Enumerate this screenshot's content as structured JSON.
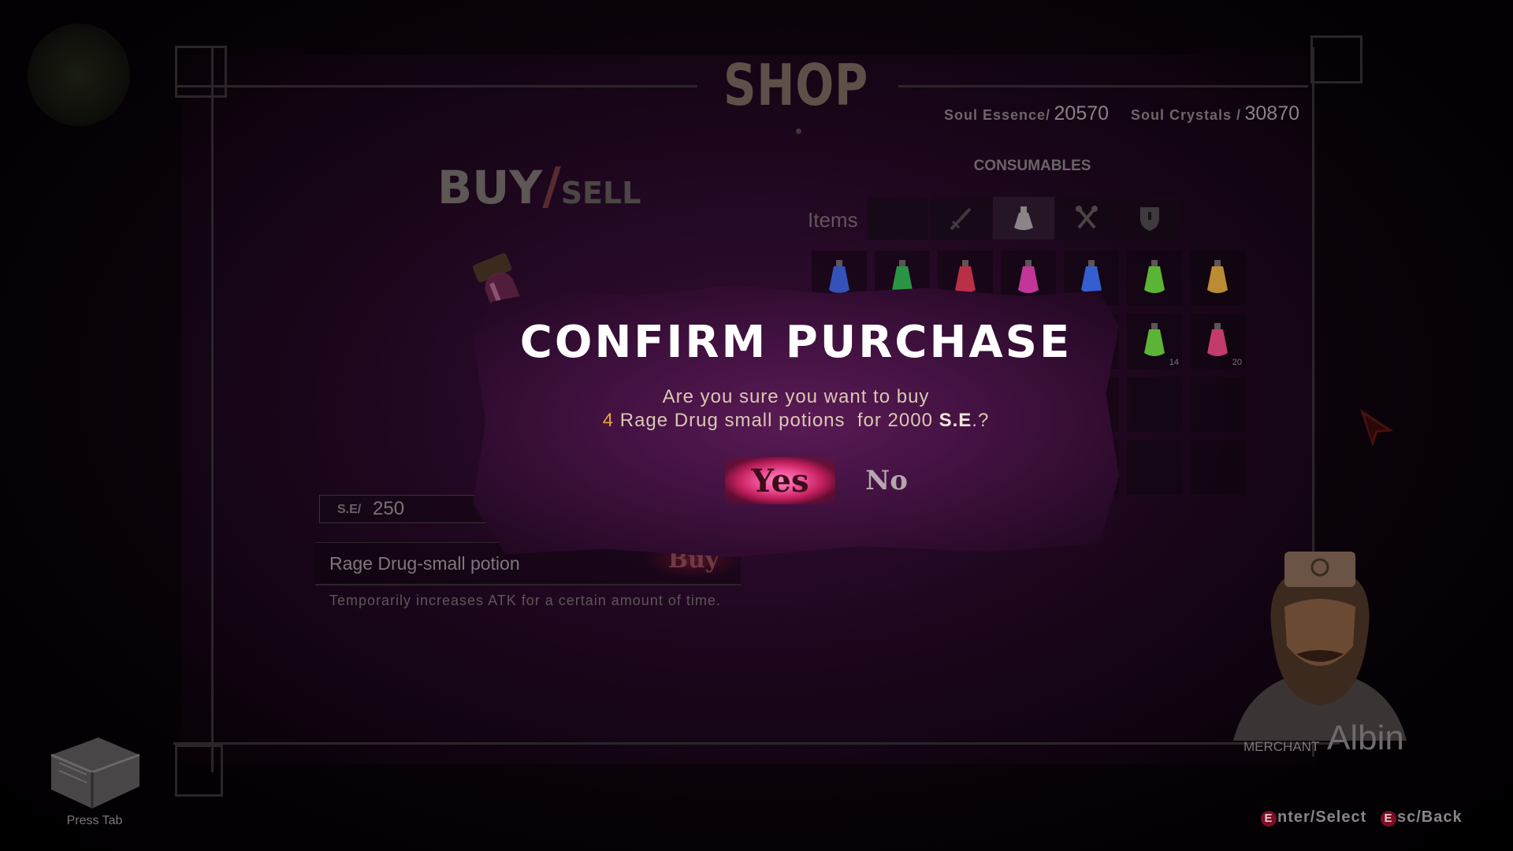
{
  "shop": {
    "title": "SHOP",
    "buy_label": "BUY",
    "slash": "/",
    "sell_label": "SELL",
    "soul_essence_label": "Soul Essence/",
    "soul_essence_value": "20570",
    "soul_crystals_label": "Soul Crystals /",
    "soul_crystals_value": "30870",
    "category": "CONSUMABLES",
    "items_label": "Items",
    "tabs": [
      {
        "icon": "empty-icon"
      },
      {
        "icon": "sword-icon"
      },
      {
        "icon": "potion-icon"
      },
      {
        "icon": "tools-icon"
      },
      {
        "icon": "shield-icon"
      }
    ],
    "potion_colors": [
      "#3a5fd6",
      "#2fae4f",
      "#d6384f",
      "#e23fb0",
      "#3b6ff0",
      "#67d33c",
      "#d9a43a"
    ],
    "second_row": [
      {
        "color": "#67d33c",
        "qty": "14"
      },
      {
        "color": "#e2457a",
        "qty": "20"
      }
    ]
  },
  "detail": {
    "price_label": "S.E/",
    "price_value": "250",
    "item_name": "Rage Drug-small potion",
    "buy_button": "Buy",
    "description": "Temporarily increases  ATK  for a certain amount of time."
  },
  "dialog": {
    "title": "CONFIRM PURCHASE",
    "line1": "Are you sure you want to buy",
    "quantity": "4",
    "item_text": " Rage Drug small potions  for 2000 ",
    "currency": "S.E",
    "suffix": ".?",
    "yes_label": "Yes",
    "no_label": "No"
  },
  "merchant": {
    "role": "MERCHANT",
    "name": "Albin"
  },
  "footer": {
    "press_tab": "Press Tab",
    "enter_key": "E",
    "enter_text": "nter/Select",
    "esc_key": "E",
    "esc_text": "sc/Back"
  },
  "colors": {
    "accent": "#e7a43b",
    "yes_glow": "#ef4f96",
    "dialog_bg": "#40113f"
  }
}
